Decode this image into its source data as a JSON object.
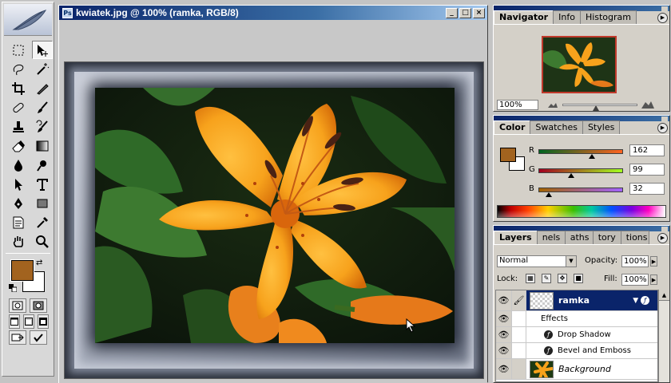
{
  "document": {
    "title": "kwiatek.jpg @ 100% (ramka, RGB/8)"
  },
  "window_buttons": {
    "minimize": "_",
    "maximize": "□",
    "close": "×"
  },
  "toolbox": {
    "tools": [
      "marquee-tool",
      "move-tool",
      "lasso-tool",
      "magic-wand-tool",
      "crop-tool",
      "slice-tool",
      "healing-brush-tool",
      "brush-tool",
      "clone-stamp-tool",
      "history-brush-tool",
      "eraser-tool",
      "gradient-tool",
      "blur-tool",
      "dodge-tool",
      "path-selection-tool",
      "type-tool",
      "pen-tool",
      "shape-tool",
      "notes-tool",
      "eyedropper-tool",
      "hand-tool",
      "zoom-tool"
    ],
    "active_tool": "move-tool",
    "foreground_color": "#a2631f",
    "background_color": "#ffffff"
  },
  "navigator": {
    "tabs": [
      "Navigator",
      "Info",
      "Histogram"
    ],
    "active_tab": "Navigator",
    "zoom": "100%",
    "zoom_level": 0.45
  },
  "color": {
    "tabs": [
      "Color",
      "Swatches",
      "Styles"
    ],
    "active_tab": "Color",
    "swatch_hex": "#a2631f",
    "r_label": "R",
    "g_label": "G",
    "b_label": "B",
    "r_value": "162",
    "g_value": "99",
    "b_value": "32",
    "r": 162,
    "g": 99,
    "b": 32
  },
  "layers": {
    "tabs": [
      "Layers",
      "nels",
      "aths",
      "tory",
      "tions"
    ],
    "active_tab": "Layers",
    "blend_mode": "Normal",
    "opacity_label": "Opacity:",
    "opacity": "100%",
    "lock_label": "Lock:",
    "fill_label": "Fill:",
    "fill": "100%",
    "items": [
      {
        "name": "ramka",
        "selected": true,
        "type": "layer"
      },
      {
        "name": "Effects",
        "type": "effects-header"
      },
      {
        "name": "Drop Shadow",
        "type": "effect"
      },
      {
        "name": "Bevel and Emboss",
        "type": "effect"
      },
      {
        "name": "Background",
        "type": "background"
      }
    ]
  },
  "icons": {
    "eye": "eye-icon",
    "brush": "brush-icon",
    "fx": "fx-icon",
    "panel_menu": "panel-menu-icon"
  },
  "colors": {
    "title_bar": "#0a246a",
    "selection": "#0a246a",
    "panel_bg": "#d4d0c8"
  }
}
